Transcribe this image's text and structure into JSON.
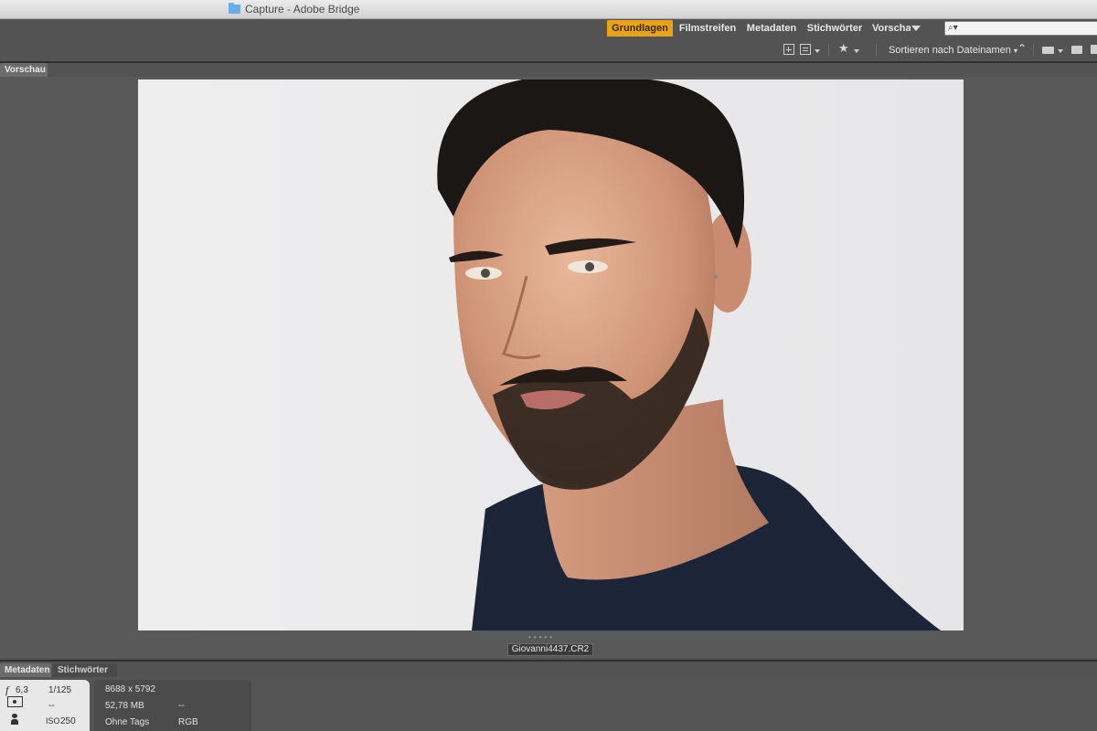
{
  "window": {
    "title": "Capture - Adobe Bridge"
  },
  "workspaces": {
    "items": [
      {
        "label": "Grundlagen",
        "active": true
      },
      {
        "label": "Filmstreifen",
        "active": false
      },
      {
        "label": "Metadaten",
        "active": false
      },
      {
        "label": "Stichwörter",
        "active": false
      },
      {
        "label": "Vorscha",
        "active": false
      }
    ],
    "search_placeholder": ""
  },
  "toolbar": {
    "sort_label": "Sortieren nach Dateinamen"
  },
  "preview_panel": {
    "tab_label": "Vorschau",
    "filename": "Giovanni4437.CR2"
  },
  "bottom_tabs": [
    {
      "label": "Metadaten",
      "active": true
    },
    {
      "label": "Stichwörter",
      "active": false
    }
  ],
  "metadata": {
    "aperture": "6,3",
    "shutter": "1/125",
    "metering": "--",
    "iso_label": "ISO",
    "iso_value": "250",
    "dimensions": "8688 x 5792",
    "file_size": "52,78 MB",
    "file_size_extra": "--",
    "tags": "Ohne Tags",
    "color_mode": "RGB"
  },
  "colors": {
    "accent": "#e8a317",
    "panel": "#535353"
  }
}
